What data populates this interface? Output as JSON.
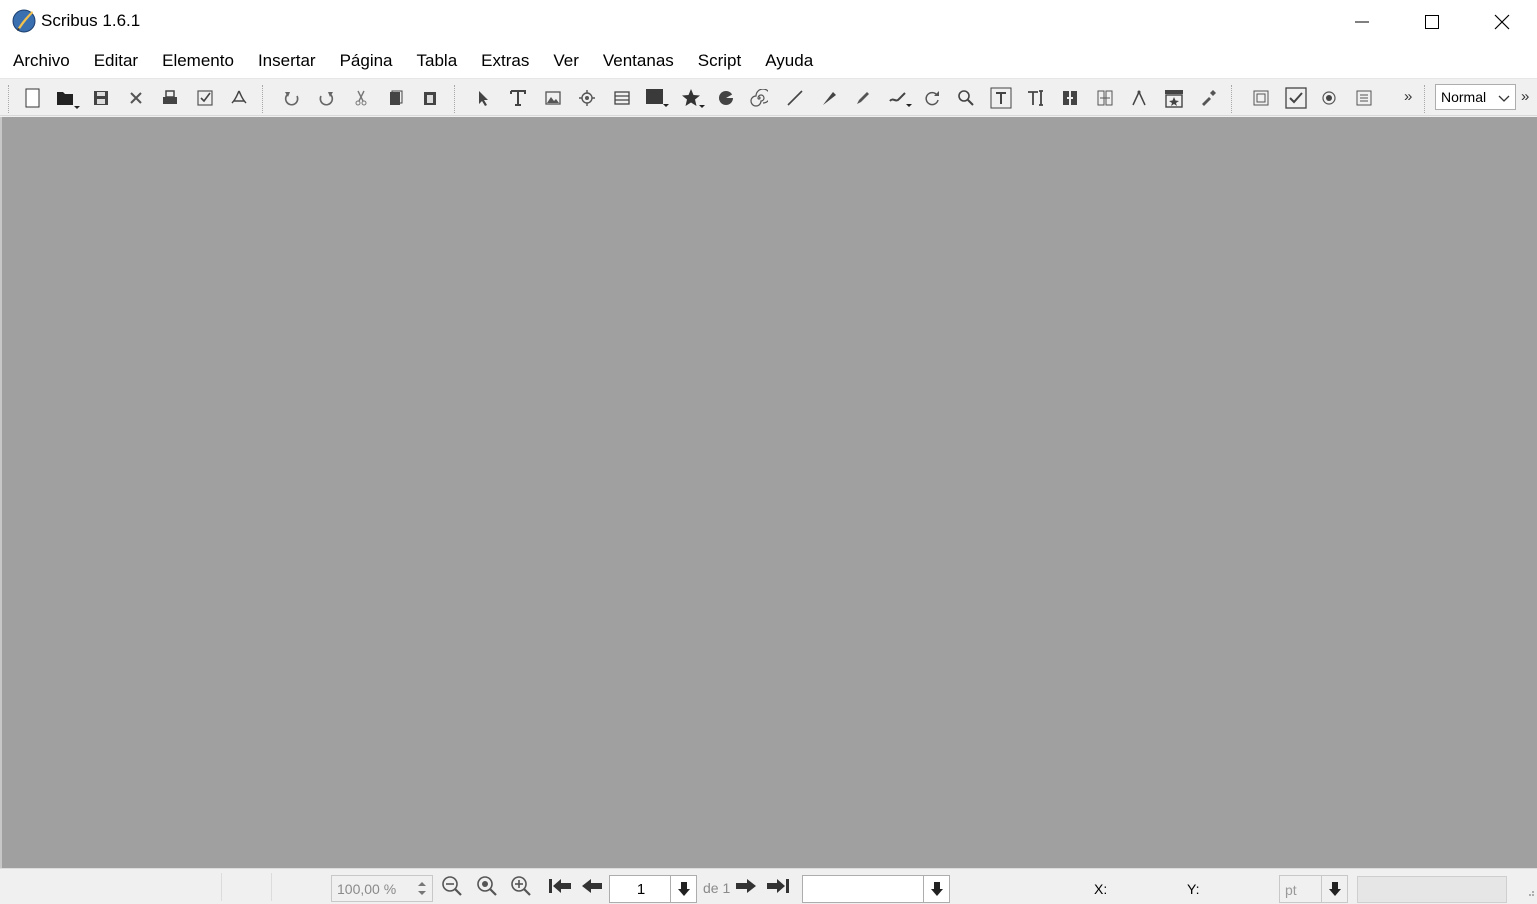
{
  "window": {
    "title": "Scribus 1.6.1",
    "controls": [
      "minimize-icon",
      "maximize-icon",
      "close-icon"
    ]
  },
  "menubar": {
    "items": [
      "Archivo",
      "Editar",
      "Elemento",
      "Insertar",
      "Página",
      "Tabla",
      "Extras",
      "Ver",
      "Ventanas",
      "Script",
      "Ayuda"
    ]
  },
  "toolbar": {
    "file_tools": [
      "new-document-icon",
      "open-icon",
      "save-icon",
      "close-document-icon",
      "print-icon",
      "preflight-check-icon",
      "export-pdf-icon"
    ],
    "edit_tools": [
      "undo-icon",
      "redo-icon",
      "cut-icon",
      "copy-icon",
      "paste-icon"
    ],
    "item_tools": [
      "select-icon",
      "text-frame-icon",
      "image-frame-icon",
      "render-frame-icon",
      "table-icon",
      "shape-icon",
      "polygon-icon",
      "arc-icon",
      "spiral-icon",
      "line-icon",
      "bezier-icon",
      "freehand-icon",
      "calligraphic-icon",
      "rotate-icon",
      "zoom-icon",
      "edit-text-icon",
      "story-editor-icon",
      "link-frames-icon",
      "unlink-frames-icon",
      "measure-icon",
      "copy-properties-icon",
      "eyedropper-icon"
    ],
    "pdf_tools": [
      "pdf-push-button-icon",
      "pdf-checkbox-icon",
      "pdf-radio-icon",
      "pdf-text-field-icon"
    ],
    "overflow_label": "»",
    "image_mode": "Normal"
  },
  "statusbar": {
    "zoom": "100,00 %",
    "page_current": "1",
    "page_of": "de 1",
    "layer": "",
    "x_label": "X:",
    "y_label": "Y:",
    "unit": "pt"
  },
  "colors": {
    "canvas": "#a0a0a0",
    "chrome": "#f0f0f0",
    "titlebar": "#ffffff"
  }
}
